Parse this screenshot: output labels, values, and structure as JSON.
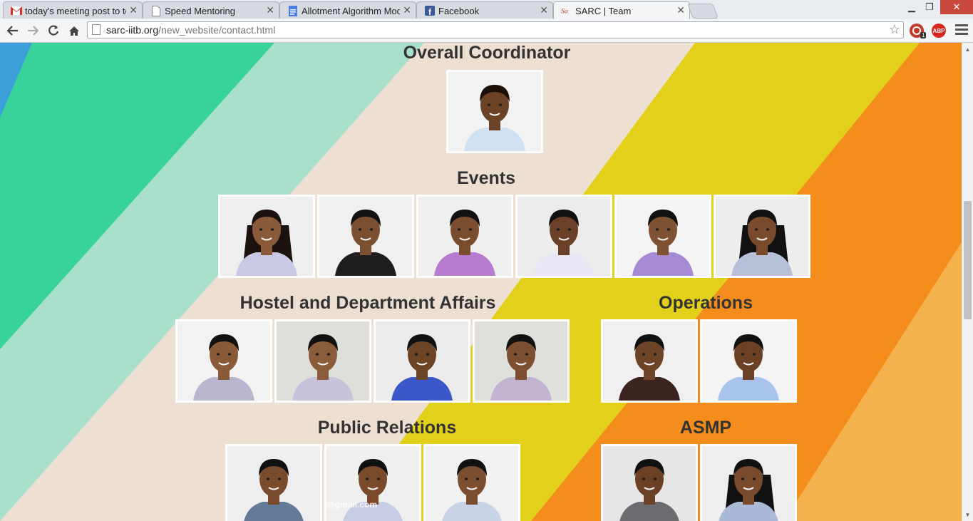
{
  "browser": {
    "tabs": [
      {
        "title": "today's meeting post to to",
        "icon": "gmail-icon"
      },
      {
        "title": "Speed Mentoring",
        "icon": "document-icon"
      },
      {
        "title": "Allotment Algorithm Mod",
        "icon": "google-docs-icon"
      },
      {
        "title": "Facebook",
        "icon": "facebook-icon"
      },
      {
        "title": "SARC | Team",
        "icon": "sarc-icon"
      }
    ],
    "address": {
      "domain": "sarc-iitb.org",
      "path": "/new_website/contact.html"
    },
    "extensions": {
      "adblock_label": "ABP",
      "badge_count": "1"
    }
  },
  "sections": {
    "overall": {
      "title": "Overall Coordinator"
    },
    "events": {
      "title": "Events"
    },
    "hostel": {
      "title": "Hostel and Department Affairs"
    },
    "operations": {
      "title": "Operations"
    },
    "pr": {
      "title": "Public Relations",
      "watermark": "@gmail.com"
    },
    "asmp": {
      "title": "ASMP"
    }
  },
  "colors": {
    "stripe_blue": "#3c9fd9",
    "stripe_green": "#38d39a",
    "stripe_mint": "#a8e0cc",
    "stripe_beige": "#ede0d3",
    "stripe_yellow": "#e3d01a",
    "stripe_orange": "#f58d1c",
    "stripe_peach": "#f3b24e"
  }
}
